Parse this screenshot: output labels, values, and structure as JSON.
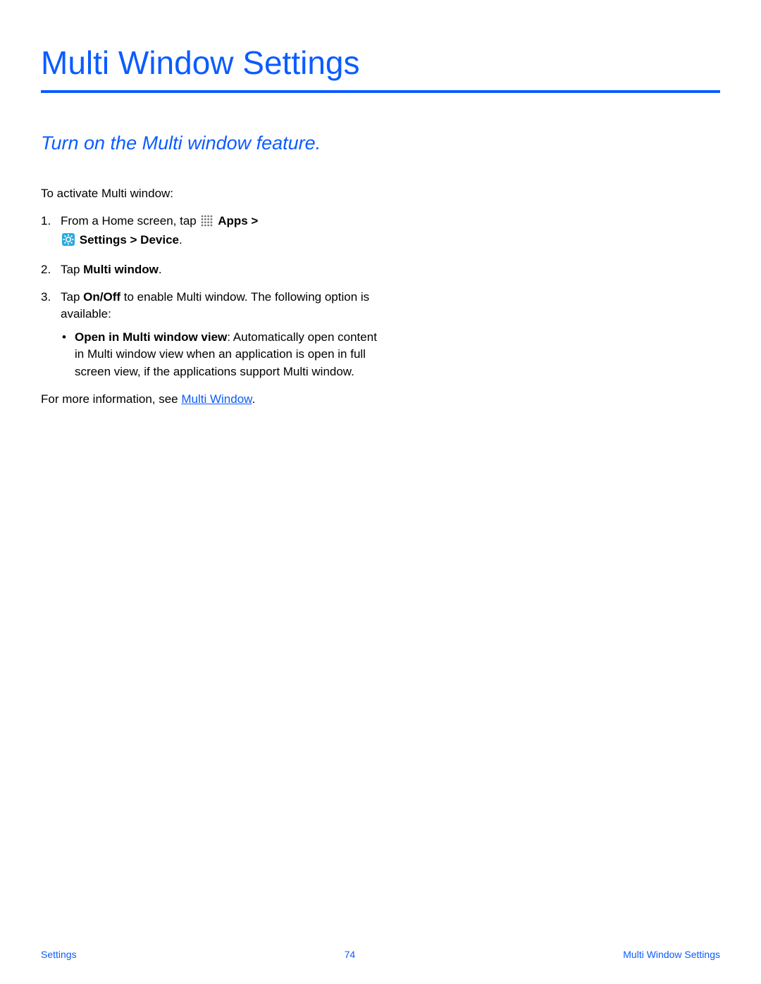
{
  "title": "Multi Window Settings",
  "subtitle": "Turn on the Multi window feature.",
  "intro": "To activate Multi window:",
  "step1_prefix": "From a Home screen, tap ",
  "step1_apps": "Apps > ",
  "step1_settings": "Settings > Device",
  "step1_period": ".",
  "step2_prefix": "Tap ",
  "step2_bold": "Multi window",
  "step2_period": ".",
  "step3_prefix": "Tap ",
  "step3_bold": "On/Off",
  "step3_suffix": " to enable Multi window. The following option is available:",
  "bullet_bold": "Open in Multi window view",
  "bullet_rest": ": Automatically open content in Multi window view when an application is open in full screen view, if the applications support Multi window.",
  "moreinfo_prefix": "For more information, see ",
  "moreinfo_link": "Multi Window",
  "moreinfo_period": ".",
  "footer": {
    "left": "Settings",
    "center": "74",
    "right": "Multi Window Settings"
  },
  "colors": {
    "accent": "#0b5cff"
  }
}
